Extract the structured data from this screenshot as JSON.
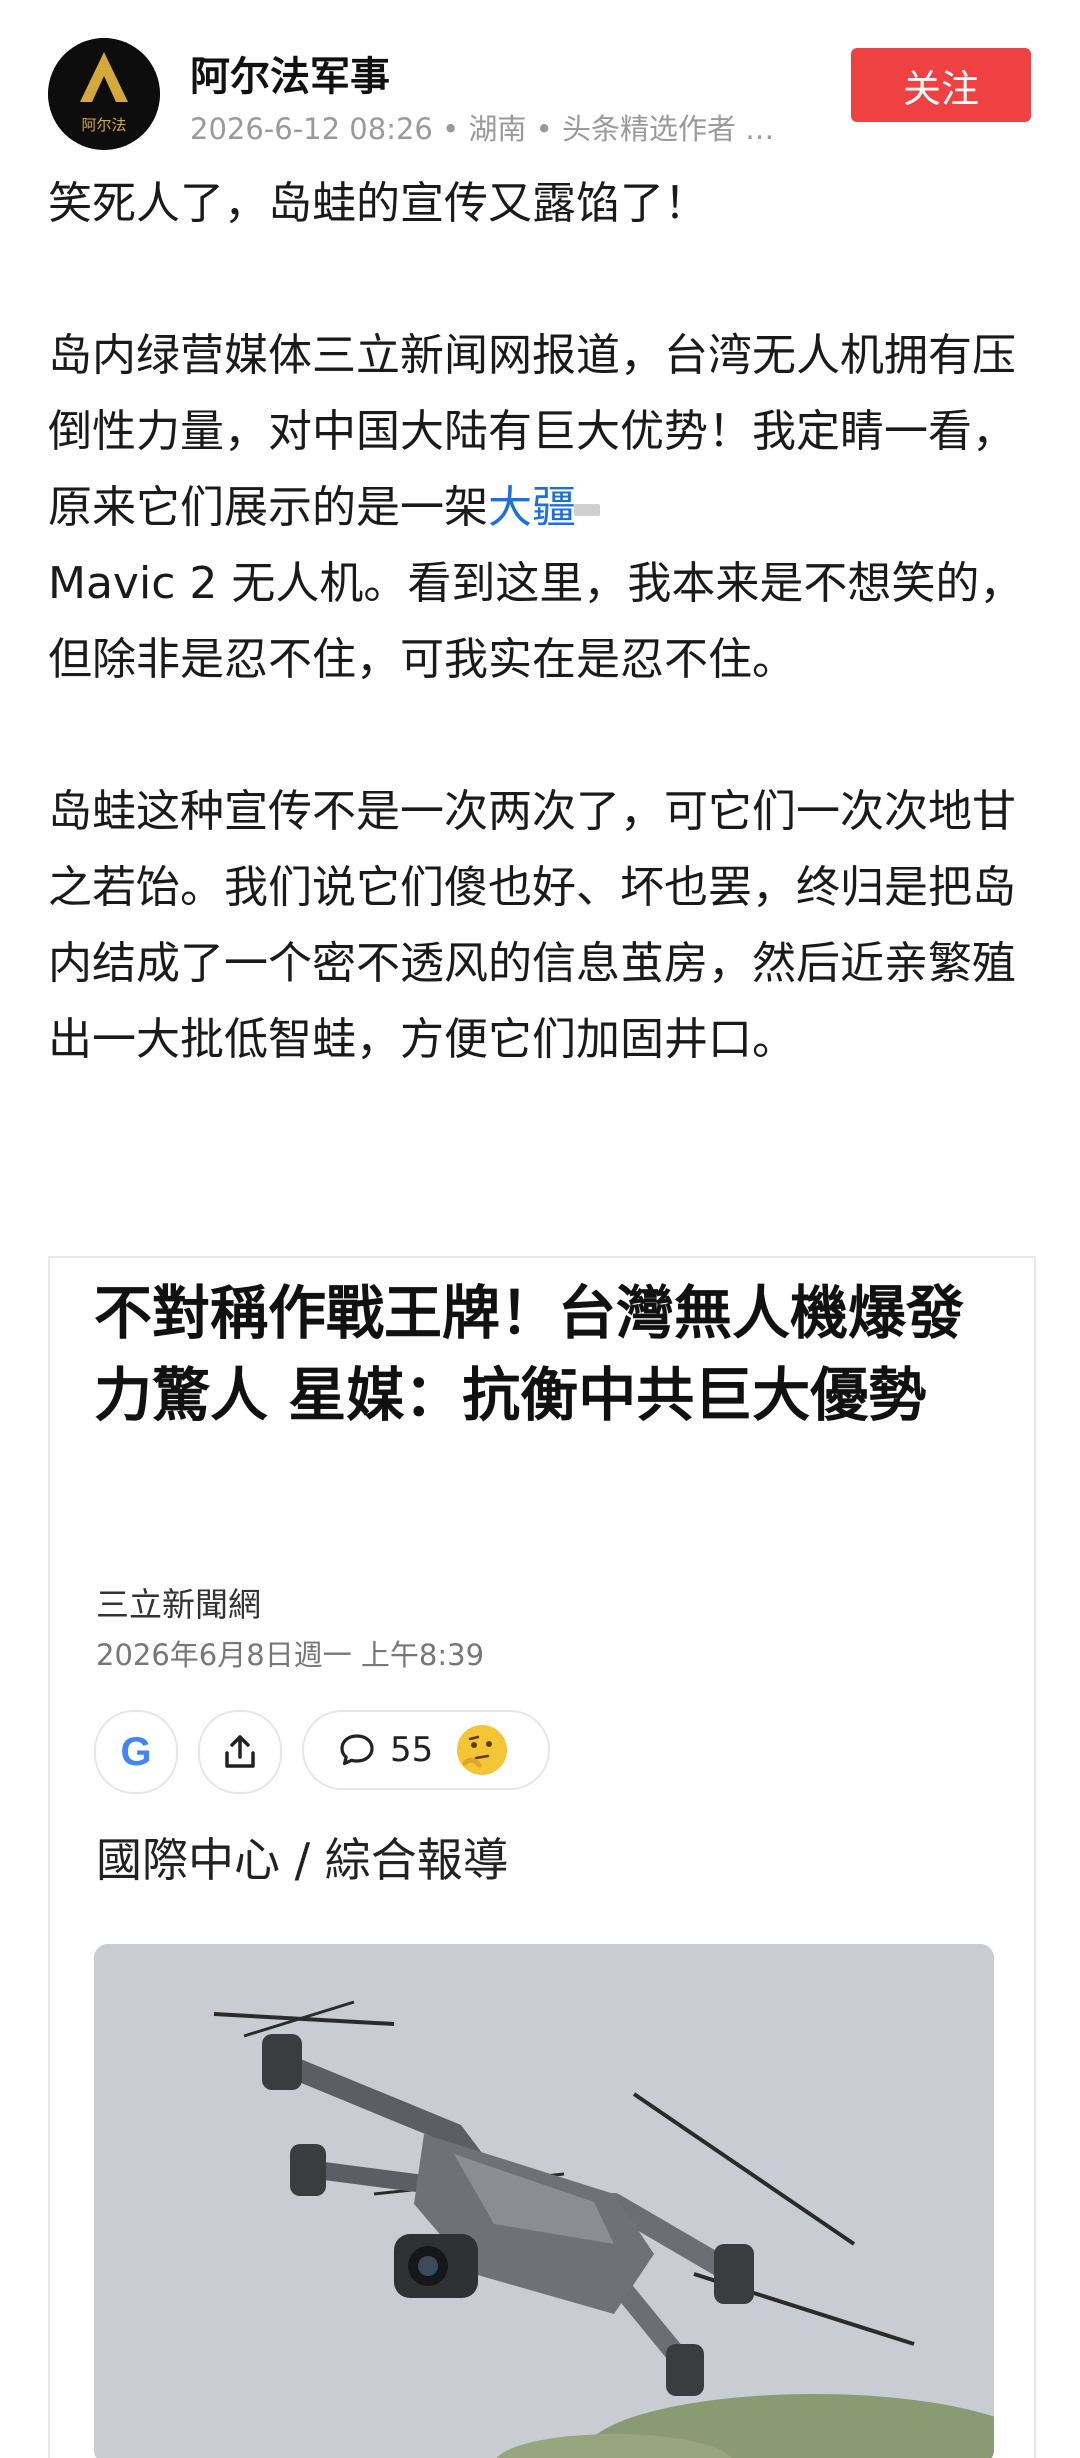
{
  "author": {
    "name": "阿尔法军事",
    "avatar_text": "阿尔法",
    "meta": "2026-6-12 08:26 • 湖南 • 头条精选作者 …"
  },
  "follow_label": "关注",
  "post": {
    "line1": "笑死人了，岛蛙的宣传又露馅了！",
    "p2_before": "岛内绿营媒体三立新闻网报道，台湾无人机拥有压倒性力量，对中国大陆有巨大优势！我定睛一看，原来它们展示的是一架",
    "p2_link": "大疆",
    "p2_after": "Mavic 2 无人机。看到这里，我本来是不想笑的，但除非是忍不住，可我实在是忍不住。",
    "p3": "岛蛙这种宣传不是一次两次了，可它们一次次地甘之若饴。我们说它们傻也好、坏也罢，终归是把岛内结成了一个密不透风的信息茧房，然后近亲繁殖出一大批低智蛙，方便它们加固井口。"
  },
  "embed": {
    "title": "不對稱作戰王牌！台灣無人機爆發力驚人 星媒：抗衡中共巨大優勢",
    "source": "三立新聞網",
    "date": "2026年6月8日週一 上午8:39",
    "google_letter": "G",
    "comment_count": "55",
    "reporter": "國際中心 / 綜合報導"
  },
  "colors": {
    "follow_bg": "#f04142",
    "link": "#1e6fd9"
  }
}
